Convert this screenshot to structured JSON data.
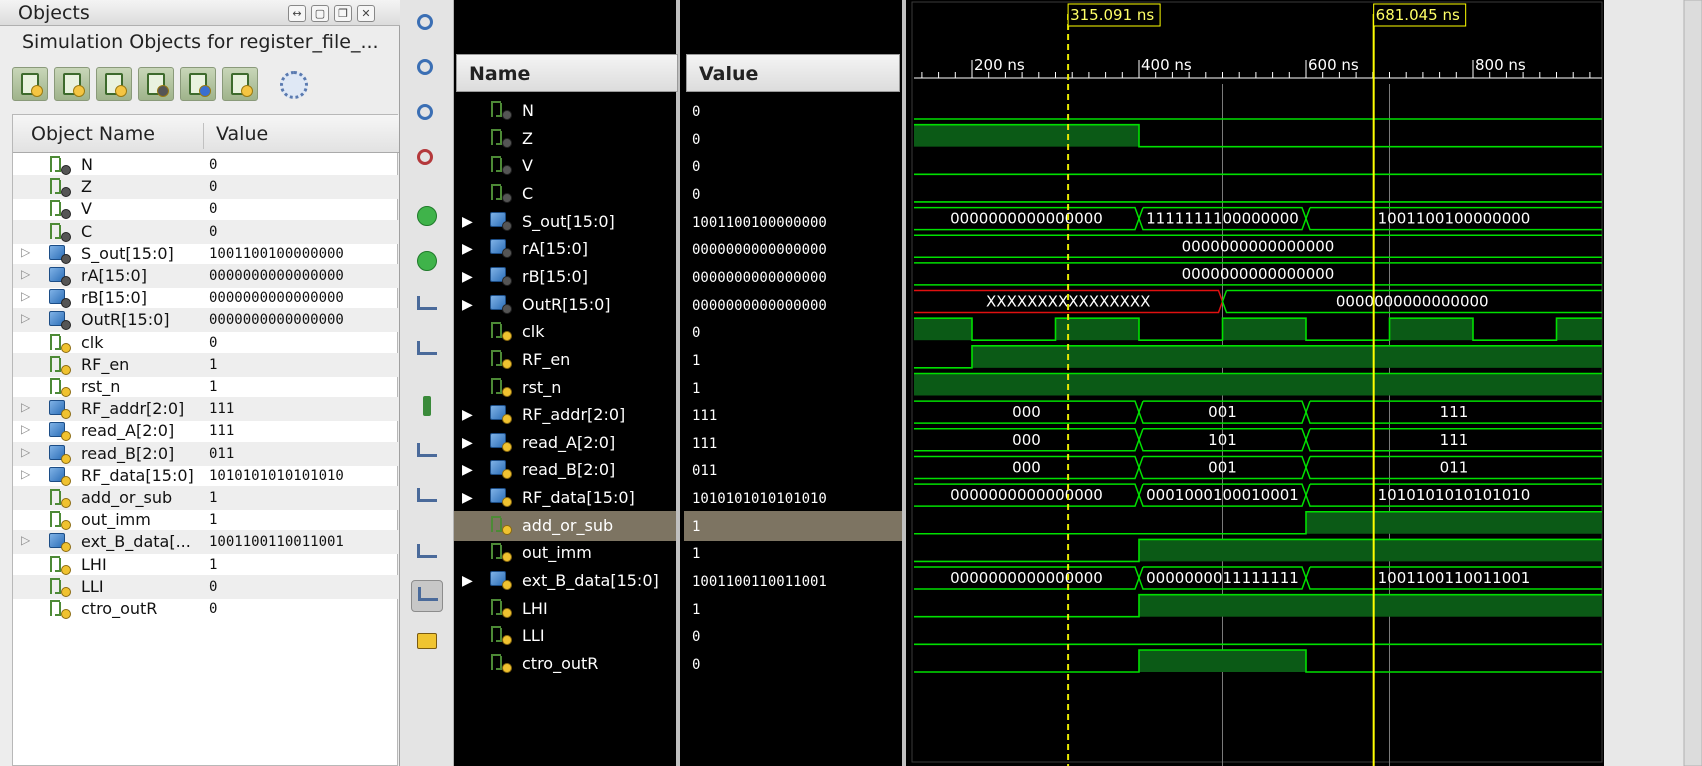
{
  "objects_panel": {
    "title": "Objects",
    "subtitle": "Simulation Objects for register_file_...",
    "window_buttons": [
      "↔",
      "▢",
      "❐",
      "✕"
    ],
    "toolbar_icons": [
      "input-ports-icon",
      "output-ports-icon",
      "inout-ports-icon",
      "internal-signals-icon",
      "constants-icon",
      "variables-icon",
      "settings-icon"
    ],
    "col_name": "Object Name",
    "col_value": "Value",
    "rows": [
      {
        "name": "N",
        "value": "0",
        "kind": "sig",
        "expandable": false
      },
      {
        "name": "Z",
        "value": "0",
        "kind": "sig",
        "expandable": false
      },
      {
        "name": "V",
        "value": "0",
        "kind": "sig",
        "expandable": false
      },
      {
        "name": "C",
        "value": "0",
        "kind": "sig",
        "expandable": false
      },
      {
        "name": "S_out[15:0]",
        "value": "1001100100000000",
        "kind": "bus",
        "expandable": true
      },
      {
        "name": "rA[15:0]",
        "value": "0000000000000000",
        "kind": "bus",
        "expandable": true
      },
      {
        "name": "rB[15:0]",
        "value": "0000000000000000",
        "kind": "bus",
        "expandable": true
      },
      {
        "name": "OutR[15:0]",
        "value": "0000000000000000",
        "kind": "bus",
        "expandable": true
      },
      {
        "name": "clk",
        "value": "0",
        "kind": "sig-in",
        "expandable": false
      },
      {
        "name": "RF_en",
        "value": "1",
        "kind": "sig-in",
        "expandable": false
      },
      {
        "name": "rst_n",
        "value": "1",
        "kind": "sig-in",
        "expandable": false
      },
      {
        "name": "RF_addr[2:0]",
        "value": "111",
        "kind": "bus-in",
        "expandable": true
      },
      {
        "name": "read_A[2:0]",
        "value": "111",
        "kind": "bus-in",
        "expandable": true
      },
      {
        "name": "read_B[2:0]",
        "value": "011",
        "kind": "bus-in",
        "expandable": true
      },
      {
        "name": "RF_data[15:0]",
        "value": "1010101010101010",
        "kind": "bus-in",
        "expandable": true
      },
      {
        "name": "add_or_sub",
        "value": "1",
        "kind": "sig-in",
        "expandable": false
      },
      {
        "name": "out_imm",
        "value": "1",
        "kind": "sig-in",
        "expandable": false
      },
      {
        "name": "ext_B_data[...",
        "value": "1001100110011001",
        "kind": "bus-in",
        "expandable": true
      },
      {
        "name": "LHI",
        "value": "1",
        "kind": "sig-in",
        "expandable": false
      },
      {
        "name": "LLI",
        "value": "0",
        "kind": "sig-in",
        "expandable": false
      },
      {
        "name": "ctro_outR",
        "value": "0",
        "kind": "sig-in",
        "expandable": false
      }
    ]
  },
  "vertical_toolbar": {
    "buttons": [
      "zoom-in-icon",
      "zoom-out-icon",
      "zoom-fit-icon",
      "zoom-to-cursor-icon",
      "go-to-start-icon",
      "go-to-end-icon",
      "previous-transition-icon",
      "next-transition-icon",
      "add-marker-icon",
      "previous-marker-icon",
      "next-marker-icon",
      "swap-cursors-icon",
      "snap-to-transition-icon",
      "floating-ruler-icon"
    ]
  },
  "waveform": {
    "name_header": "Name",
    "value_header": "Value",
    "cursors": {
      "primary_label": "315.091 ns",
      "primary_time_ns": 315.091,
      "secondary_label": "681.045 ns",
      "secondary_time_ns": 681.045
    },
    "time_axis": {
      "ticks": [
        "200 ns",
        "400 ns",
        "600 ns",
        "800 ns"
      ],
      "tick_values_ns": [
        200,
        400,
        600,
        800
      ],
      "view_start_ns": 130,
      "view_end_ns": 955
    },
    "selected_row": "add_or_sub",
    "signals": [
      {
        "name": "N",
        "value": "0",
        "kind": "sig",
        "wave": {
          "type": "bit",
          "segments": [
            [
              0,
              955,
              0
            ]
          ]
        }
      },
      {
        "name": "Z",
        "value": "0",
        "kind": "sig",
        "wave": {
          "type": "bit",
          "segments": [
            [
              0,
              400,
              1
            ],
            [
              400,
              955,
              0
            ]
          ]
        }
      },
      {
        "name": "V",
        "value": "0",
        "kind": "sig",
        "wave": {
          "type": "bit",
          "segments": [
            [
              0,
              955,
              0
            ]
          ]
        }
      },
      {
        "name": "C",
        "value": "0",
        "kind": "sig",
        "wave": {
          "type": "bit",
          "segments": [
            [
              0,
              955,
              0
            ]
          ]
        }
      },
      {
        "name": "S_out[15:0]",
        "value": "1001100100000000",
        "kind": "bus",
        "expandable": true,
        "wave": {
          "type": "bus",
          "segments": [
            [
              0,
              400,
              "0000000000000000"
            ],
            [
              400,
              600,
              "1111111100000000"
            ],
            [
              600,
              955,
              "1001100100000000"
            ]
          ]
        }
      },
      {
        "name": "rA[15:0]",
        "value": "0000000000000000",
        "kind": "bus",
        "expandable": true,
        "wave": {
          "type": "bus",
          "segments": [
            [
              0,
              955,
              "0000000000000000"
            ]
          ]
        }
      },
      {
        "name": "rB[15:0]",
        "value": "0000000000000000",
        "kind": "bus",
        "expandable": true,
        "wave": {
          "type": "bus",
          "segments": [
            [
              0,
              955,
              "0000000000000000"
            ]
          ]
        }
      },
      {
        "name": "OutR[15:0]",
        "value": "0000000000000000",
        "kind": "bus",
        "expandable": true,
        "wave": {
          "type": "bus",
          "segments": [
            [
              0,
              500,
              "XXXXXXXXXXXXXXXX",
              "x"
            ],
            [
              500,
              955,
              "0000000000000000"
            ]
          ]
        }
      },
      {
        "name": "clk",
        "value": "0",
        "kind": "sig-in",
        "wave": {
          "type": "bit",
          "segments": [
            [
              0,
              200,
              1
            ],
            [
              200,
              300,
              0
            ],
            [
              300,
              400,
              1
            ],
            [
              400,
              500,
              0
            ],
            [
              500,
              600,
              1
            ],
            [
              600,
              700,
              0
            ],
            [
              700,
              800,
              1
            ],
            [
              800,
              900,
              0
            ],
            [
              900,
              955,
              1
            ]
          ]
        }
      },
      {
        "name": "RF_en",
        "value": "1",
        "kind": "sig-in",
        "wave": {
          "type": "bit",
          "segments": [
            [
              0,
              200,
              0
            ],
            [
              200,
              955,
              1
            ]
          ]
        }
      },
      {
        "name": "rst_n",
        "value": "1",
        "kind": "sig-in",
        "wave": {
          "type": "bit",
          "segments": [
            [
              0,
              955,
              1
            ]
          ]
        }
      },
      {
        "name": "RF_addr[2:0]",
        "value": "111",
        "kind": "bus-in",
        "expandable": true,
        "wave": {
          "type": "bus",
          "segments": [
            [
              0,
              400,
              "000"
            ],
            [
              400,
              600,
              "001"
            ],
            [
              600,
              955,
              "111"
            ]
          ]
        }
      },
      {
        "name": "read_A[2:0]",
        "value": "111",
        "kind": "bus-in",
        "expandable": true,
        "wave": {
          "type": "bus",
          "segments": [
            [
              0,
              400,
              "000"
            ],
            [
              400,
              600,
              "101"
            ],
            [
              600,
              955,
              "111"
            ]
          ]
        }
      },
      {
        "name": "read_B[2:0]",
        "value": "011",
        "kind": "bus-in",
        "expandable": true,
        "wave": {
          "type": "bus",
          "segments": [
            [
              0,
              400,
              "000"
            ],
            [
              400,
              600,
              "001"
            ],
            [
              600,
              955,
              "011"
            ]
          ]
        }
      },
      {
        "name": "RF_data[15:0]",
        "value": "1010101010101010",
        "kind": "bus-in",
        "expandable": true,
        "wave": {
          "type": "bus",
          "segments": [
            [
              0,
              400,
              "0000000000000000"
            ],
            [
              400,
              600,
              "0001000100010001"
            ],
            [
              600,
              955,
              "1010101010101010"
            ]
          ]
        }
      },
      {
        "name": "add_or_sub",
        "value": "1",
        "kind": "sig-in",
        "wave": {
          "type": "bit",
          "segments": [
            [
              0,
              600,
              0
            ],
            [
              600,
              955,
              1
            ]
          ]
        }
      },
      {
        "name": "out_imm",
        "value": "1",
        "kind": "sig-in",
        "wave": {
          "type": "bit",
          "segments": [
            [
              0,
              400,
              0
            ],
            [
              400,
              955,
              1
            ]
          ]
        }
      },
      {
        "name": "ext_B_data[15:0]",
        "value": "1001100110011001",
        "kind": "bus-in",
        "expandable": true,
        "wave": {
          "type": "bus",
          "segments": [
            [
              0,
              400,
              "0000000000000000"
            ],
            [
              400,
              600,
              "0000000011111111"
            ],
            [
              600,
              955,
              "1001100110011001"
            ]
          ]
        }
      },
      {
        "name": "LHI",
        "value": "1",
        "kind": "sig-in",
        "wave": {
          "type": "bit",
          "segments": [
            [
              0,
              400,
              0
            ],
            [
              400,
              955,
              1
            ]
          ]
        }
      },
      {
        "name": "LLI",
        "value": "0",
        "kind": "sig-in",
        "wave": {
          "type": "bit",
          "segments": [
            [
              0,
              955,
              0
            ]
          ]
        }
      },
      {
        "name": "ctro_outR",
        "value": "0",
        "kind": "sig-in",
        "wave": {
          "type": "bit",
          "segments": [
            [
              0,
              400,
              0
            ],
            [
              400,
              600,
              1
            ],
            [
              600,
              955,
              0
            ]
          ]
        }
      }
    ]
  },
  "colors": {
    "wave_green": "#00e000",
    "wave_fill": "#0b5a16",
    "x_red": "#e01010",
    "cursor_yellow": "#ffff00",
    "cursor_dashed": "#e8e800",
    "selection": "#7d7462"
  }
}
